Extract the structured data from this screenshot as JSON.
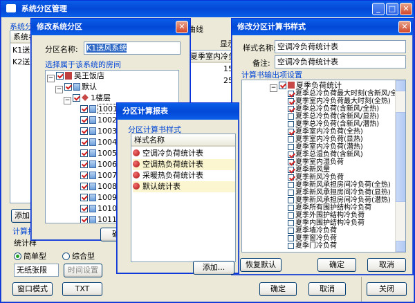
{
  "main": {
    "title": "系统分区管理",
    "min": "_",
    "max": "□",
    "close": "✕",
    "left_group": "系统分",
    "left_col": "系统名",
    "left_rows": [
      "K1送风",
      "K2送风"
    ],
    "add_btn": "添加",
    "calc_group": "计算报",
    "stat_label": "统计样",
    "radio_simple": "简单型",
    "radio_combined": "综合型",
    "limit_select": "无纸张限",
    "time_btn": "时间设置",
    "win_mode": "窗口模式",
    "txt_btn": "TXT",
    "close_btn": "关闭",
    "tab_partial": "曲线",
    "show_partial": "显示",
    "right_col": "夏季室内冷负荷",
    "right_vals": [
      "15",
      "25"
    ]
  },
  "sys_dialog": {
    "title": "修改系统分区",
    "name_label": "分区名称:",
    "name_value": "K1送风系统",
    "group": "选择属于该系统的房间",
    "tree": [
      "吴王饭店",
      "默认",
      "1楼层",
      "1001[下一大堂]",
      "1002",
      "1003",
      "1004",
      "1005",
      "1006",
      "1007",
      "1008",
      "1009",
      "1010",
      "1011",
      "1012"
    ],
    "ok": "确定"
  },
  "report_dialog": {
    "title": "分区计算报表",
    "group": "分区计算书样式",
    "col": "样式名称",
    "items": [
      "空调冷负荷统计表",
      "空调热负荷统计表",
      "采暖热负荷统计表",
      "默认统计表"
    ],
    "add": "添加..."
  },
  "style_dialog": {
    "title": "修改分区计算书样式",
    "name_label": "样式名称:",
    "name_value": "空调冷负荷统计表",
    "note_label": "备注:",
    "note_value": "空调冷负荷统计表",
    "group": "计算书输出项设置",
    "root": "夏季负荷统计",
    "items": [
      {
        "label": "夏季总冷负荷最大时刻(含新风/全",
        "on": true
      },
      {
        "label": "夏季室内冷负荷最大时刻(全热)",
        "on": true
      },
      {
        "label": "夏季总冷负荷(含新风/全热)",
        "on": true
      },
      {
        "label": "夏季总冷负荷(含新风/显热)",
        "on": false
      },
      {
        "label": "夏季总冷负荷(含新风/潜热)",
        "on": false
      },
      {
        "label": "夏季室内冷负荷(全热)",
        "on": true
      },
      {
        "label": "夏季室内冷负荷(显热)",
        "on": false
      },
      {
        "label": "夏季室内冷负荷(潜热)",
        "on": false
      },
      {
        "label": "夏季总湿负荷(含新风)",
        "on": true
      },
      {
        "label": "夏季室内湿负荷",
        "on": true
      },
      {
        "label": "夏季新风量",
        "on": true
      },
      {
        "label": "夏季新风冷负荷",
        "on": true
      },
      {
        "label": "夏季新风承担房间冷负荷(全热)",
        "on": false
      },
      {
        "label": "夏季新风承担房间冷负荷(显热)",
        "on": false
      },
      {
        "label": "夏季新风承担房间冷负荷(潜热)",
        "on": false
      },
      {
        "label": "夏季所有围护结构冷负荷",
        "on": false
      },
      {
        "label": "夏季外围护结构冷负荷",
        "on": false
      },
      {
        "label": "夏季内围护结构冷负荷",
        "on": false
      },
      {
        "label": "夏季墙冷负荷",
        "on": false
      },
      {
        "label": "夏季窗冷负荷",
        "on": false
      },
      {
        "label": "夏季门冷负荷",
        "on": false
      }
    ],
    "restore": "恢复默认",
    "ok": "确定",
    "cancel": "取消"
  },
  "bottom_ok": "确定",
  "bottom_cancel": "取消"
}
